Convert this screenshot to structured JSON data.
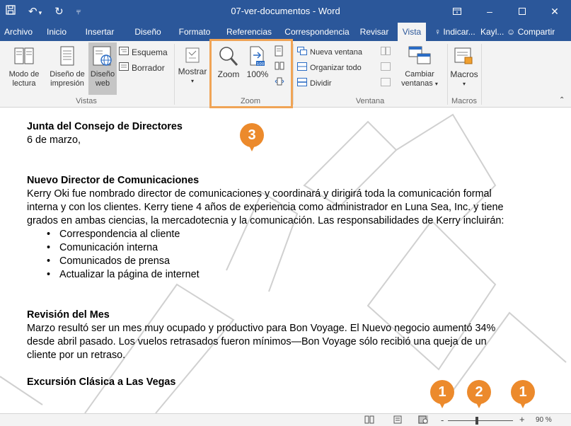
{
  "window": {
    "title": "07-ver-documentos - Word"
  },
  "tabs": [
    "Archivo",
    "Inicio",
    "Insertar",
    "Diseño",
    "Formato",
    "Referencias",
    "Correspondencia",
    "Revisar",
    "Vista"
  ],
  "active_tab": "Vista",
  "tell_me": "Indicar...",
  "user": "Kayl...",
  "share": "Compartir",
  "ribbon": {
    "vistas": {
      "modo_lectura_1": "Modo de",
      "modo_lectura_2": "lectura",
      "diseno_impresion_1": "Diseño de",
      "diseno_impresion_2": "impresión",
      "diseno_web_1": "Diseño",
      "diseno_web_2": "web",
      "esquema": "Esquema",
      "borrador": "Borrador",
      "label": "Vistas"
    },
    "mostrar": "Mostrar",
    "zoom": {
      "zoom": "Zoom",
      "cien": "100%",
      "label": "Zoom"
    },
    "ventana": {
      "nueva": "Nueva ventana",
      "organizar": "Organizar todo",
      "dividir": "Dividir",
      "cambiar_1": "Cambiar",
      "cambiar_2": "ventanas",
      "label": "Ventana"
    },
    "macros": {
      "macros": "Macros",
      "label": "Macros"
    }
  },
  "document": {
    "heading1": "Junta del Consejo de Directores",
    "date": "6 de marzo,",
    "heading2": "Nuevo Director de Comunicaciones",
    "para1_l1": "Kerry Oki fue nombrado director de comunicaciones y coordinará y dirigirá toda la comunicación formal",
    "para1_l2": "interna y con los clientes. Kerry tiene 4 años de experiencia como administrador en Luna Sea, Inc. y tiene",
    "para1_l3": "grados en ambas ciencias, la mercadotecnia y la comunicación. Las responsabilidades de Kerry incluirán:",
    "bullets": [
      "Correspondencia al cliente",
      "Comunicación interna",
      "Comunicados de prensa",
      "Actualizar la página de internet"
    ],
    "heading3": "Revisión del Mes",
    "para2_l1": "Marzo resultó ser un mes muy ocupado y productivo para Bon Voyage. El Nuevo negocio aumentó 34%",
    "para2_l2": "desde abril pasado. Los vuelos retrasados fueron mínimos—Bon Voyage sólo recibió una queja de un",
    "para2_l3": "cliente por un retraso.",
    "heading4": "Excursión Clásica a Las Vegas"
  },
  "callouts": {
    "ribbon": "3",
    "zoom_out": "1",
    "slider": "2",
    "zoom_in": "1"
  },
  "status": {
    "minus": "-",
    "plus": "+",
    "zoom_level": "90 %",
    "zoom_fraction": 0.45
  },
  "colors": {
    "word_blue": "#2b579a",
    "callout_orange": "#ec8a2c",
    "highlight_orange": "#f0a456"
  }
}
